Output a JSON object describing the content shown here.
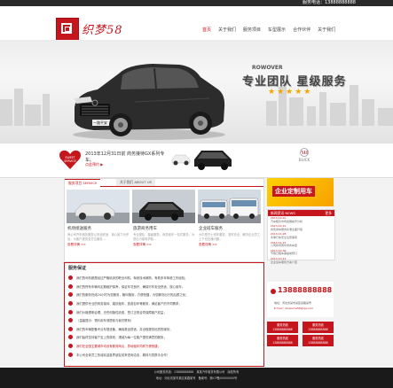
{
  "topbar": {
    "hotline": "服务电话：13888888888"
  },
  "header": {
    "site_name": "织梦58",
    "nav": [
      "首页",
      "关于我们",
      "服务项目",
      "车型展示",
      "合作伙伴",
      "关于我们"
    ]
  },
  "banner": {
    "brand": "ROWOVER",
    "slogan": "专业团队 星级服务",
    "stars": "★★★★★",
    "plate": "一路平安"
  },
  "promo": {
    "text": "2013年12月31日前 商务接待GX系列专车。",
    "link": "点此预约 ▶",
    "badge_line1": "SWEET",
    "badge_line2": "SERVICE",
    "logo_caption": "BUICK"
  },
  "panel": {
    "tab1": "服务项目 SERVICE",
    "tab2": "关于我们 ABOUT US",
    "cards": [
      {
        "title": "机场接送服务",
        "desc": "我公司汽车租赁服务以安全舒适、省心省力为宗旨，为客户提供全方位服务...",
        "more": "查看详情 >>"
      },
      {
        "title": "旅游商务用车",
        "desc": "专业团队、星级服务，商务租车一站式服务，为您出行保驾护航...",
        "more": "查看详情 >>"
      },
      {
        "title": "企业班车服务",
        "desc": "大中型巴士班车服务，准时安全，解决企业员工上下班交通问题...",
        "more": "查看详情 >>"
      }
    ]
  },
  "service": {
    "title": "服务保证",
    "items": [
      {
        "text": "我们的司机都是经过严格培训的职业司机，驾驶技术娴熟，有着多年驾驶工作经验；",
        "red": false
      },
      {
        "text": "我们的所有车辆均定期维护保养，保证车况良好，确保行车安全舒适，放心用车；",
        "red": false
      },
      {
        "text": "我们的服务热线24小时为您服务，随叫随到，方便快捷，为您解决出行的后顾之忧；",
        "red": false
      },
      {
        "text": "我们提供专业的商务接待、婚庆租车、旅游包车等服务，满足客户的不同需求；",
        "red": false
      },
      {
        "text": "我们价格透明合理，无任何隐性收费，签订正规合同保障客户权益；",
        "red": false
      },
      {
        "text": "（温馨提示：预约用车请提前与我们联系）",
        "red": false
      },
      {
        "text": "我们的车辆配备专业车载设备，确保乘坐舒适，并全程提供优质的服务；",
        "red": false
      },
      {
        "text": "我们始终坚持客户至上的原则，竭诚为每一位客户提供满意的服务；",
        "red": false
      },
      {
        "text": "我们在全国主要城市均设有服务网点，异地租车同样方便快捷；",
        "red": true
      },
      {
        "text": "本公司全体员工热诚欢迎各界朋友前来咨询洽谈，期待与您携手合作！",
        "red": false
      }
    ]
  },
  "right": {
    "ad": "企业定制用车",
    "news_title": "新闻资讯 NEWS",
    "news_more": "更多",
    "news": [
      {
        "date": "2013-12-20",
        "title": "汽车租赁市场发展前景分析"
      },
      {
        "date": "2013-12-10",
        "title": "商务用车服务标准全面升级"
      },
      {
        "date": "2013-11-28",
        "title": "冬季行车安全注意事项"
      },
      {
        "date": "2013-11-15",
        "title": "公司新增豪华商务车型"
      },
      {
        "date": "2013-10-30",
        "title": "节假日租车需提前预订"
      },
      {
        "date": "2013-10-12",
        "title": "企业班车服务方案介绍"
      }
    ],
    "phone": "13888888888",
    "address": "地址：河北省某市某区某路某号",
    "email": "E-mail：dedecms58@qq.com",
    "services": [
      {
        "label": "服务热线",
        "number": "13888888888"
      },
      {
        "label": "服务热线",
        "number": "13888888888"
      },
      {
        "label": "服务热线",
        "number": "13888888888"
      },
      {
        "label": "服务热线",
        "number": "13888888888"
      }
    ]
  },
  "footer": {
    "line1": "公司服务热线：13888888888　某某汽车租赁有限公司　版权所有",
    "line2": "地址：河北省某市某区某路某号　备案号：冀ICP备00000000号"
  },
  "colors": {
    "accent": "#c5161d",
    "dark": "#1a1a1a",
    "gold": "#f5a500"
  }
}
